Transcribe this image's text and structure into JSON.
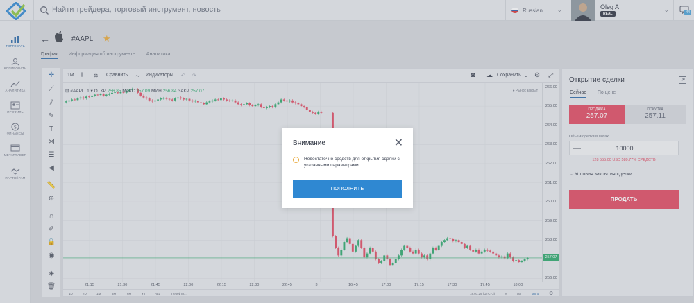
{
  "search": {
    "placeholder": "Найти трейдера, торговый инструмент, новость"
  },
  "language": {
    "label": "Russian"
  },
  "user": {
    "name": "Oleg A",
    "badge": "REAL"
  },
  "chat": {
    "badge": "44"
  },
  "sidebar": {
    "items": [
      {
        "label": "ТОРГОВАТЬ",
        "icon": "chart-icon",
        "active": true
      },
      {
        "label": "КОПИРОВАТЬ",
        "icon": "copy-people-icon",
        "active": false
      },
      {
        "label": "АНАЛИТИКА",
        "icon": "analytics-icon",
        "active": false
      },
      {
        "label": "ПРОФИЛЬ",
        "icon": "profile-icon",
        "active": false
      },
      {
        "label": "ФИНАНСЫ",
        "icon": "finance-icon",
        "active": false
      },
      {
        "label": "METATRADER",
        "icon": "metatrader-icon",
        "active": false
      },
      {
        "label": "ПАРТНЁРАМ",
        "icon": "handshake-icon",
        "active": false
      }
    ]
  },
  "instrument": {
    "symbol": "#AAPL",
    "tabs": [
      "График",
      "Информация об инструменте",
      "Аналитика"
    ]
  },
  "chart_toolbar": {
    "interval": "1M",
    "compare": "Сравнить",
    "indicators": "Индикаторы",
    "save": "Сохранить"
  },
  "chart_legend": {
    "symbol": "#AAPL, 1",
    "open_label": "ОТКР",
    "open": "256.85",
    "high_label": "МАКС",
    "high": "257.09",
    "low_label": "МИН",
    "low": "256.84",
    "close_label": "ЗАКР",
    "close": "257.07",
    "market_status": "Рынок закрыт"
  },
  "chart_data": {
    "type": "candlestick",
    "y_ticks": [
      "266.00",
      "265.00",
      "264.00",
      "263.00",
      "262.00",
      "261.00",
      "260.00",
      "259.00",
      "258.00",
      "257.00",
      "256.00"
    ],
    "ylim": [
      255.8,
      266.2
    ],
    "x_ticks": [
      "21:15",
      "21:30",
      "21:45",
      "22:00",
      "22:15",
      "22:30",
      "22:45",
      "3",
      "16:45",
      "17:00",
      "17:15",
      "17:30",
      "17:45",
      "18:00"
    ],
    "last_price": "257.07",
    "series": [
      {
        "name": "",
        "close": [
          265.25,
          265.3,
          265.35,
          265.32,
          265.4,
          265.45,
          265.4,
          265.5,
          265.48,
          265.55,
          265.6,
          265.58,
          265.62,
          265.55,
          265.6,
          265.65,
          265.7,
          265.72,
          265.68,
          265.75,
          265.7,
          265.8,
          265.85,
          265.9,
          265.88,
          265.7,
          265.55,
          265.45,
          265.4,
          265.3,
          265.25,
          265.3,
          265.35,
          265.4,
          265.42,
          265.38,
          265.35,
          265.3,
          265.4,
          265.45,
          265.4,
          265.35,
          265.38,
          265.3,
          265.25,
          265.28,
          265.2,
          265.15,
          265.1,
          265.2,
          265.25,
          265.3,
          265.35,
          265.32,
          265.4,
          265.35,
          265.3,
          265.28,
          265.3,
          265.2,
          265.1,
          265.05,
          265.1,
          265.15,
          265.05,
          265.0,
          265.05,
          265.1,
          264.95,
          264.9,
          264.95,
          265.0,
          264.95,
          265.1,
          265.2,
          265.35,
          265.3,
          265.25,
          265.3,
          265.2,
          265.15,
          265.1,
          265.0,
          264.95,
          264.8,
          264.7,
          264.65,
          264.6,
          264.7,
          264.65,
          258.2,
          257.6,
          257.2,
          257.5,
          257.9,
          258.1,
          257.8,
          257.4,
          257.7,
          258.0,
          257.6,
          257.1,
          257.3,
          257.6,
          257.4,
          257.0,
          256.8,
          256.9,
          257.2,
          257.0,
          256.7,
          256.8,
          257.0,
          257.2,
          257.5,
          257.7,
          257.6,
          257.4,
          257.3,
          257.5,
          257.3,
          257.1,
          257.2,
          257.0,
          257.3,
          257.6,
          257.5,
          257.7,
          257.9,
          258.0,
          258.1,
          258.05,
          257.95,
          258.0,
          257.9,
          257.8,
          257.6,
          257.7,
          257.5,
          257.4,
          257.5,
          257.3,
          257.4,
          257.5,
          257.45,
          257.4,
          257.3,
          257.2,
          257.1,
          257.15,
          257.05,
          257.3,
          257.1,
          256.9,
          256.95,
          256.85,
          256.9,
          257.0,
          257.07
        ]
      }
    ]
  },
  "chart_bottom": {
    "ranges": [
      "1D",
      "7D",
      "1M",
      "3M",
      "6M",
      "YT",
      "ALL"
    ],
    "goto": "Перейти...",
    "clock": "18:07:29 (UTC+3)",
    "percent": "%",
    "log": "лог",
    "auto": "авто"
  },
  "trade_panel": {
    "title": "Открытие сделки",
    "tabs": [
      "Сейчас",
      "По цене"
    ],
    "sell_label": "ПРОДАЖА",
    "sell_price": "257.07",
    "buy_label": "ПОКУПКА",
    "buy_price": "257.11",
    "volume_label": "Объем сделки в лотах",
    "volume": "10000",
    "volume_info": "128 555.00 USD   589.77% СРЕДСТВ",
    "close_conditions": "Условия закрытия сделки",
    "sell_button": "ПРОДАТЬ"
  },
  "modal": {
    "title": "Внимание",
    "message": "Недостаточно средств для открытия сделки с указанными параметрами",
    "button": "ПОПОЛНИТЬ"
  },
  "colors": {
    "up": "#2aa76a",
    "down": "#e0475f",
    "accent": "#2f88d2"
  }
}
